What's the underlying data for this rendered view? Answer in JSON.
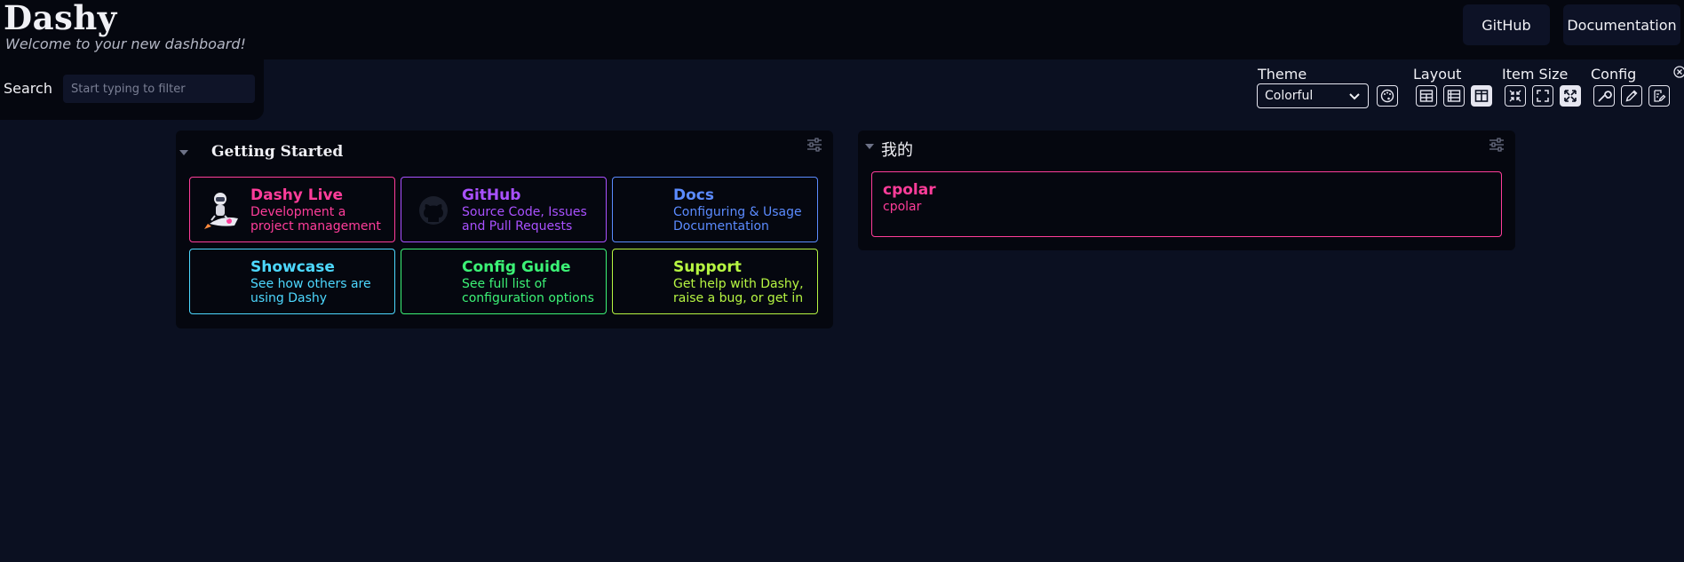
{
  "header": {
    "title": "Dashy",
    "subtitle": "Welcome to your new dashboard!",
    "nav": [
      {
        "label": "GitHub"
      },
      {
        "label": "Documentation"
      }
    ]
  },
  "search": {
    "label": "Search",
    "placeholder": "Start typing to filter"
  },
  "settings": {
    "theme_label": "Theme",
    "theme_value": "Colorful",
    "layout_label": "Layout",
    "item_size_label": "Item Size",
    "config_label": "Config"
  },
  "sections": [
    {
      "title": "Getting Started",
      "items": [
        {
          "title": "Dashy Live",
          "description": "Development a project management",
          "color": "#ff3d9a"
        },
        {
          "title": "GitHub",
          "description": "Source Code, Issues and Pull Requests",
          "color": "#a951ff"
        },
        {
          "title": "Docs",
          "description": "Configuring & Usage Documentation",
          "color": "#5b8bff"
        },
        {
          "title": "Showcase",
          "description": "See how others are using Dashy",
          "color": "#4dd8ff"
        },
        {
          "title": "Config Guide",
          "description": "See full list of configuration options",
          "color": "#3cf276"
        },
        {
          "title": "Support",
          "description": "Get help with Dashy, raise a bug, or get in",
          "color": "#b6f542"
        }
      ]
    },
    {
      "title": "我的",
      "items": [
        {
          "title": "cpolar",
          "description": "cpolar",
          "color": "#ff3d9a"
        }
      ]
    }
  ],
  "colors": {
    "background": "#0b1021",
    "header": "#05070f"
  }
}
